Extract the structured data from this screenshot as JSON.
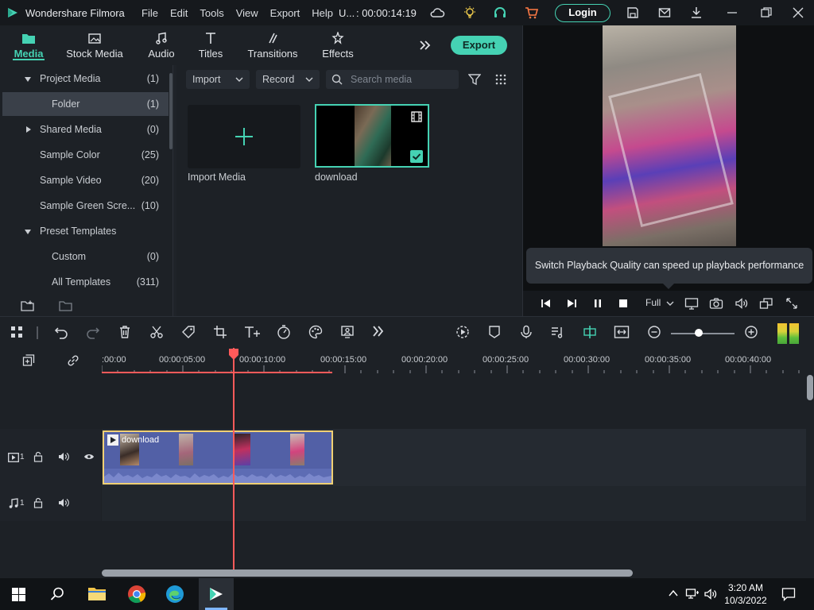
{
  "window": {
    "app_title": "Wondershare Filmora",
    "menu": [
      "File",
      "Edit",
      "Tools",
      "View",
      "Export",
      "Help"
    ],
    "project_name": "U...",
    "duration": ": 00:00:14:19",
    "login_label": "Login"
  },
  "nav_tabs": [
    {
      "label": "Media",
      "icon": "media-icon"
    },
    {
      "label": "Stock Media",
      "icon": "stock-media-icon"
    },
    {
      "label": "Audio",
      "icon": "audio-icon"
    },
    {
      "label": "Titles",
      "icon": "titles-icon"
    },
    {
      "label": "Transitions",
      "icon": "transitions-icon"
    },
    {
      "label": "Effects",
      "icon": "effects-icon"
    }
  ],
  "export_label": "Export",
  "sidebar": {
    "items": [
      {
        "label": "Project Media",
        "count": "(1)"
      },
      {
        "label": "Folder",
        "count": "(1)"
      },
      {
        "label": "Shared Media",
        "count": "(0)"
      },
      {
        "label": "Sample Color",
        "count": "(25)"
      },
      {
        "label": "Sample Video",
        "count": "(20)"
      },
      {
        "label": "Sample Green Scre...",
        "count": "(10)"
      },
      {
        "label": "Preset Templates",
        "count": ""
      },
      {
        "label": "Custom",
        "count": "(0)"
      },
      {
        "label": "All Templates",
        "count": "(311)"
      }
    ]
  },
  "media_toolbar": {
    "import_label": "Import",
    "record_label": "Record",
    "search_placeholder": "Search media"
  },
  "media_items": {
    "import_label": "Import Media",
    "clip_name": "download"
  },
  "preview": {
    "tooltip": "Switch Playback Quality can speed up playback performance",
    "quality": "Full"
  },
  "timeline": {
    "ruler_labels": [
      ":00:00",
      "00:00:05:00",
      "00:00:10:00",
      "00:00:15:00",
      "00:00:20:00",
      "00:00:25:00",
      "00:00:30:00",
      "00:00:35:00",
      "00:00:40:00"
    ],
    "video_track_label": "1",
    "audio_track_label": "1",
    "clip_label": "download"
  },
  "taskbar": {
    "time": "3:20 AM",
    "date": "10/3/2022"
  },
  "colors": {
    "accent": "#45d2b3",
    "clip": "#5260a6",
    "clip_border": "#f0d074",
    "playhead": "#ff5a5a"
  }
}
